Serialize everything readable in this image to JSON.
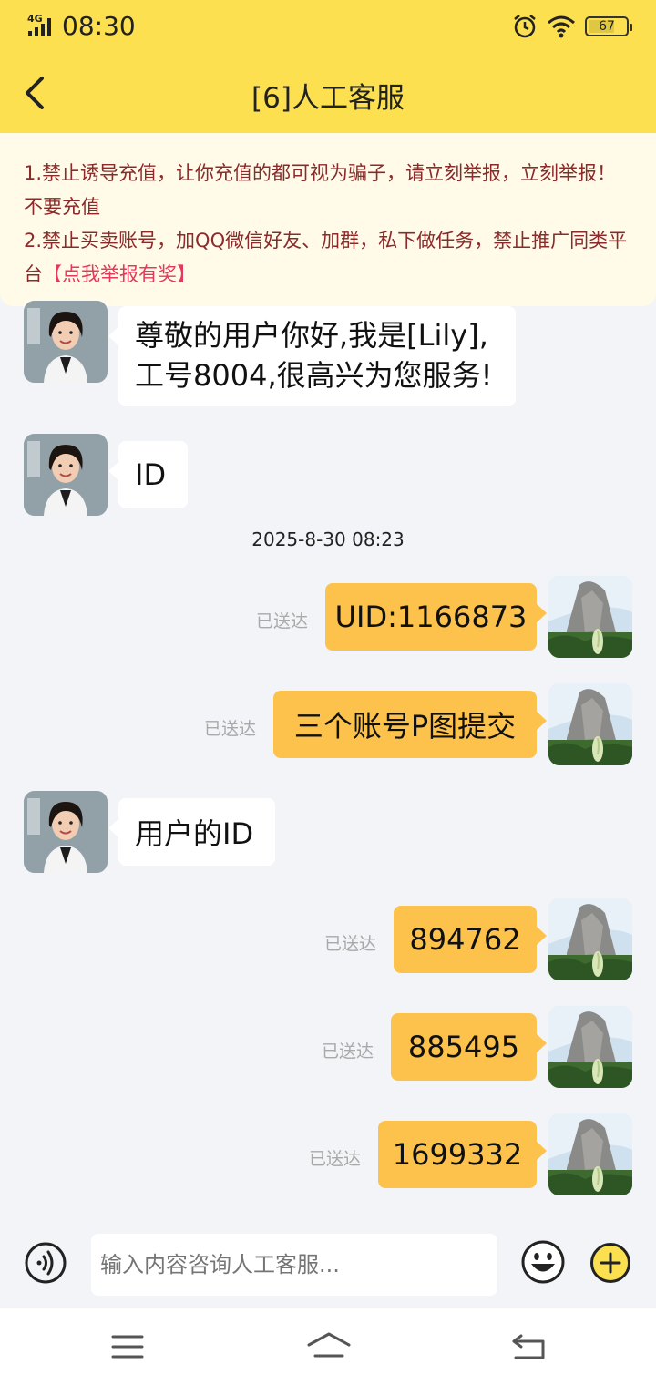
{
  "status_bar": {
    "network": "4G",
    "time": "08:30",
    "battery": "67"
  },
  "header": {
    "title": "[6]人工客服"
  },
  "notice": {
    "line1": "1.禁止诱导充值，让你充值的都可视为骗子，请立刻举报，立刻举报！不要充值",
    "line2_main": "2.禁止买卖账号，加QQ微信好友、加群，私下做任务，禁止推广同类平台",
    "line2_link": "【点我举报有奖】"
  },
  "messages": {
    "m1_line1": "尊敬的用户你好,我是[Lily],",
    "m1_line2": "工号8004,很高兴为您服务!",
    "m2": "ID",
    "timestamp": "2025-8-30 08:23",
    "m3": "UID:1166873",
    "m4": "三个账号P图提交",
    "m5": "用户的ID",
    "m6": "894762",
    "m7": "885495",
    "m8": "1699332",
    "delivered": "已送达"
  },
  "input": {
    "placeholder": "输入内容咨询人工客服..."
  },
  "colors": {
    "header": "#fce04f",
    "outgoing_bubble": "#fcc24c",
    "notice_link": "#e4395d"
  }
}
